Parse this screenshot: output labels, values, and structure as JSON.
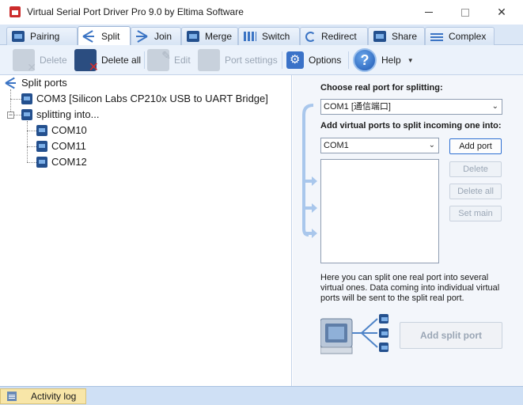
{
  "window": {
    "title": "Virtual Serial Port Driver Pro 9.0 by Eltima Software"
  },
  "tabs": [
    {
      "label": "Pairing",
      "icon": "port-pair-icon"
    },
    {
      "label": "Split",
      "icon": "split-icon",
      "active": true
    },
    {
      "label": "Join",
      "icon": "join-icon"
    },
    {
      "label": "Merge",
      "icon": "merge-icon"
    },
    {
      "label": "Switch",
      "icon": "switch-icon"
    },
    {
      "label": "Redirect",
      "icon": "redirect-icon"
    },
    {
      "label": "Share",
      "icon": "share-icon"
    },
    {
      "label": "Complex",
      "icon": "complex-icon"
    }
  ],
  "toolbar": {
    "delete": "Delete",
    "delete_all": "Delete all",
    "edit": "Edit",
    "port_settings": "Port settings",
    "options": "Options",
    "help": "Help"
  },
  "tree": {
    "root": "Split ports",
    "real_port": "COM3 [Silicon Labs CP210x USB to UART Bridge]",
    "splitting_into": "splitting into...",
    "virtual_ports": [
      "COM10",
      "COM11",
      "COM12"
    ]
  },
  "split_form": {
    "real_port_label": "Choose real port for splitting:",
    "real_port_value": "COM1 [通信端口]",
    "virtual_label": "Add virtual ports to split incoming one into:",
    "virtual_value": "COM1",
    "add_port": "Add port",
    "delete": "Delete",
    "delete_all": "Delete all",
    "set_main": "Set main",
    "info": "Here you can split one real port into several virtual ones. Data coming into individual virtual ports will be sent to the split real port.",
    "add_split_port": "Add split port"
  },
  "status": {
    "activity_log": "Activity log"
  },
  "colors": {
    "accent": "#2d6fd2",
    "tab_bar": "#dbe7f6",
    "toolbar": "#ebf2fb",
    "activity_tab": "#f8e6a8"
  }
}
